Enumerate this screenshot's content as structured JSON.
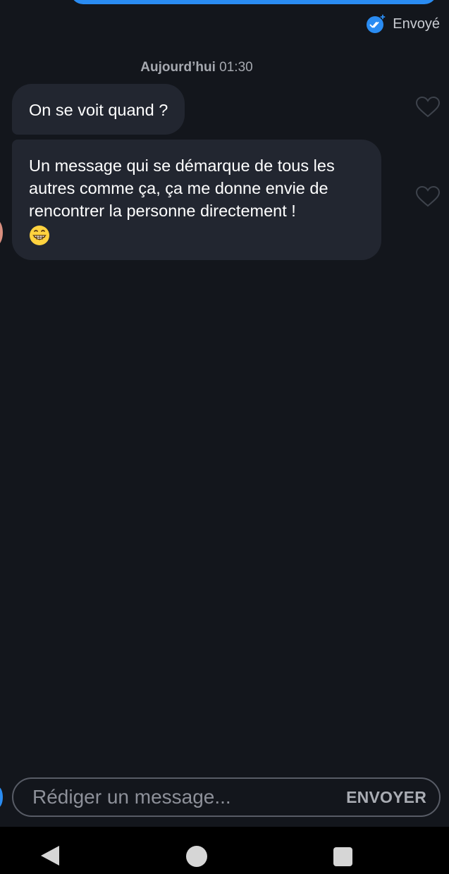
{
  "status": {
    "sent_label": "Envoyé"
  },
  "conversation": {
    "timestamp_day": "Aujourd’hui",
    "timestamp_time": "01:30",
    "messages": [
      {
        "text": "On se voit quand ?"
      },
      {
        "text": "Un message qui se démarque de tous les autres comme ça, ça me donne envie de rencontrer la personne directement !",
        "emoji": "grinning-face"
      }
    ]
  },
  "composer": {
    "placeholder": "Rédiger un message...",
    "send_label": "ENVOYER"
  },
  "colors": {
    "background": "#13161c",
    "bubble": "#222630",
    "accent": "#2a8cf2"
  }
}
